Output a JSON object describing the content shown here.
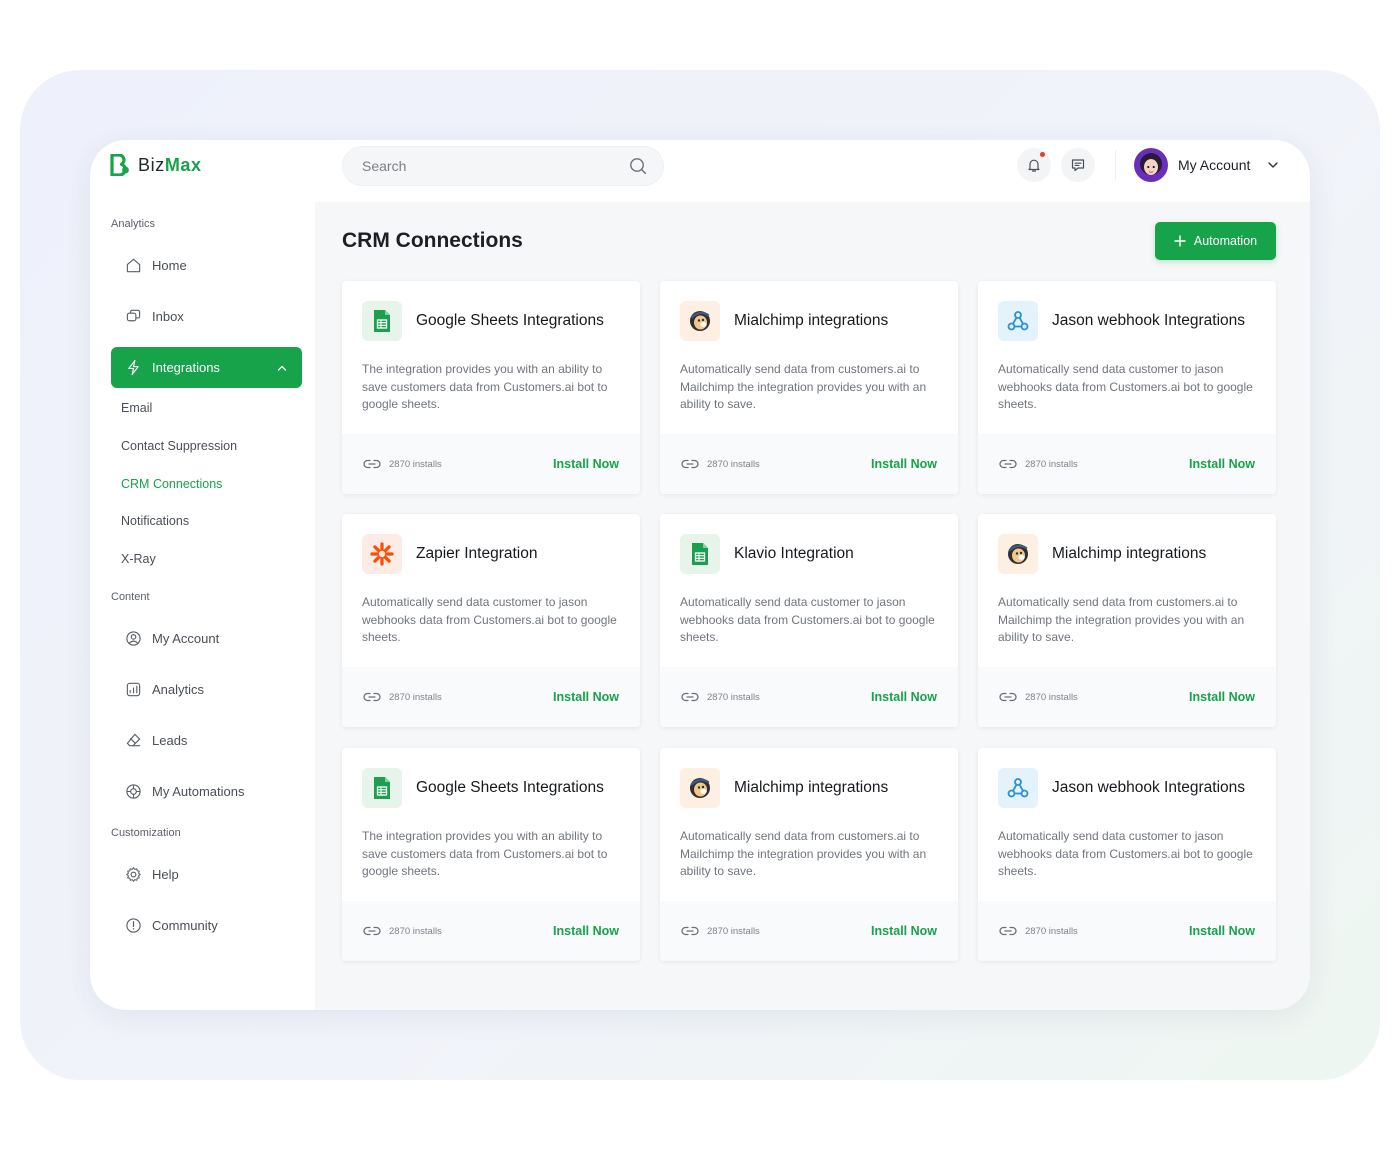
{
  "brand": {
    "name_a": "Biz",
    "name_b": "Max"
  },
  "search": {
    "placeholder": "Search"
  },
  "account": {
    "label": "My Account"
  },
  "sidebar": {
    "sections": [
      "Analytics",
      "Content",
      "Customization"
    ],
    "items": [
      {
        "label": "Home",
        "icon": "home-icon"
      },
      {
        "label": "Inbox",
        "icon": "inbox-icon"
      },
      {
        "label": "Integrations",
        "icon": "bolt-icon",
        "active": true
      },
      {
        "label": "My Account",
        "icon": "user-circle-icon"
      },
      {
        "label": "Analytics",
        "icon": "chart-icon"
      },
      {
        "label": "Leads",
        "icon": "eraser-icon"
      },
      {
        "label": "My Automations",
        "icon": "settings-wheel-icon"
      },
      {
        "label": "Help",
        "icon": "gear-icon"
      },
      {
        "label": "Community",
        "icon": "info-icon"
      }
    ],
    "subitems": [
      "Email",
      "Contact Suppression",
      "CRM Connections",
      "Notifications",
      "X-Ray"
    ],
    "active_subitem": "CRM Connections"
  },
  "main": {
    "title": "CRM Connections",
    "add_button": "Automation",
    "cards": [
      {
        "icon": "google-sheets-icon",
        "title": "Google Sheets Integrations",
        "desc": "The integration provides you with an ability to save customers data from Customers.ai bot to google sheets.",
        "installs": "2870 installs",
        "action": "Install Now"
      },
      {
        "icon": "mailchimp-icon",
        "title": "Mialchimp integrations",
        "desc": "Automatically send data from customers.ai to Mailchimp the integration provides you with an ability to save.",
        "installs": "2870 installs",
        "action": "Install Now"
      },
      {
        "icon": "webhook-icon",
        "title": "Jason webhook Integrations",
        "desc": "Automatically send data customer to jason webhooks data from Customers.ai bot to google sheets.",
        "installs": "2870 installs",
        "action": "Install Now"
      },
      {
        "icon": "zapier-icon",
        "title": "Zapier Integration",
        "desc": "Automatically send data customer to jason webhooks data from Customers.ai bot to google sheets.",
        "installs": "2870 installs",
        "action": "Install Now"
      },
      {
        "icon": "google-sheets-icon",
        "title": "Klavio Integration",
        "desc": "Automatically send data customer to jason webhooks data from Customers.ai bot to google sheets.",
        "installs": "2870 installs",
        "action": "Install Now"
      },
      {
        "icon": "mailchimp-icon",
        "title": "Mialchimp integrations",
        "desc": "Automatically send data from customers.ai to Mailchimp the integration provides you with an ability to save.",
        "installs": "2870 installs",
        "action": "Install Now"
      },
      {
        "icon": "google-sheets-icon",
        "title": "Google Sheets Integrations",
        "desc": "The integration provides you with an ability to save customers data from Customers.ai bot to google sheets.",
        "installs": "2870 installs",
        "action": "Install Now"
      },
      {
        "icon": "mailchimp-icon",
        "title": "Mialchimp integrations",
        "desc": "Automatically send data from customers.ai to Mailchimp the integration provides you with an ability to save.",
        "installs": "2870 installs",
        "action": "Install Now"
      },
      {
        "icon": "webhook-icon",
        "title": "Jason webhook Integrations",
        "desc": "Automatically send data customer to jason webhooks data from Customers.ai bot to google sheets.",
        "installs": "2870 installs",
        "action": "Install Now"
      }
    ]
  },
  "colors": {
    "accent": "#17a34a",
    "notification_dot": "#e53935"
  }
}
